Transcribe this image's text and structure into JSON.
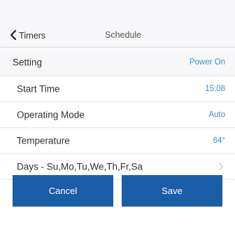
{
  "header": {
    "back_label": "Timers",
    "title": "Schedule"
  },
  "rows": [
    {
      "label": "Setting",
      "value": "Power On"
    },
    {
      "label": "Start Time",
      "value": "15:08"
    },
    {
      "label": "Operating Mode",
      "value": "Auto"
    },
    {
      "label": "Temperature",
      "value": "64°"
    },
    {
      "label": "Days - Su,Mo,Tu,We,Th,Fr,Sa"
    }
  ],
  "actions": {
    "cancel_label": "Cancel",
    "save_label": "Save"
  },
  "colors": {
    "accent": "#1a5ea8",
    "value_text": "#3b8fd6"
  },
  "icons": {
    "back": "chevron-left-icon",
    "days": "chevron-right-icon"
  }
}
